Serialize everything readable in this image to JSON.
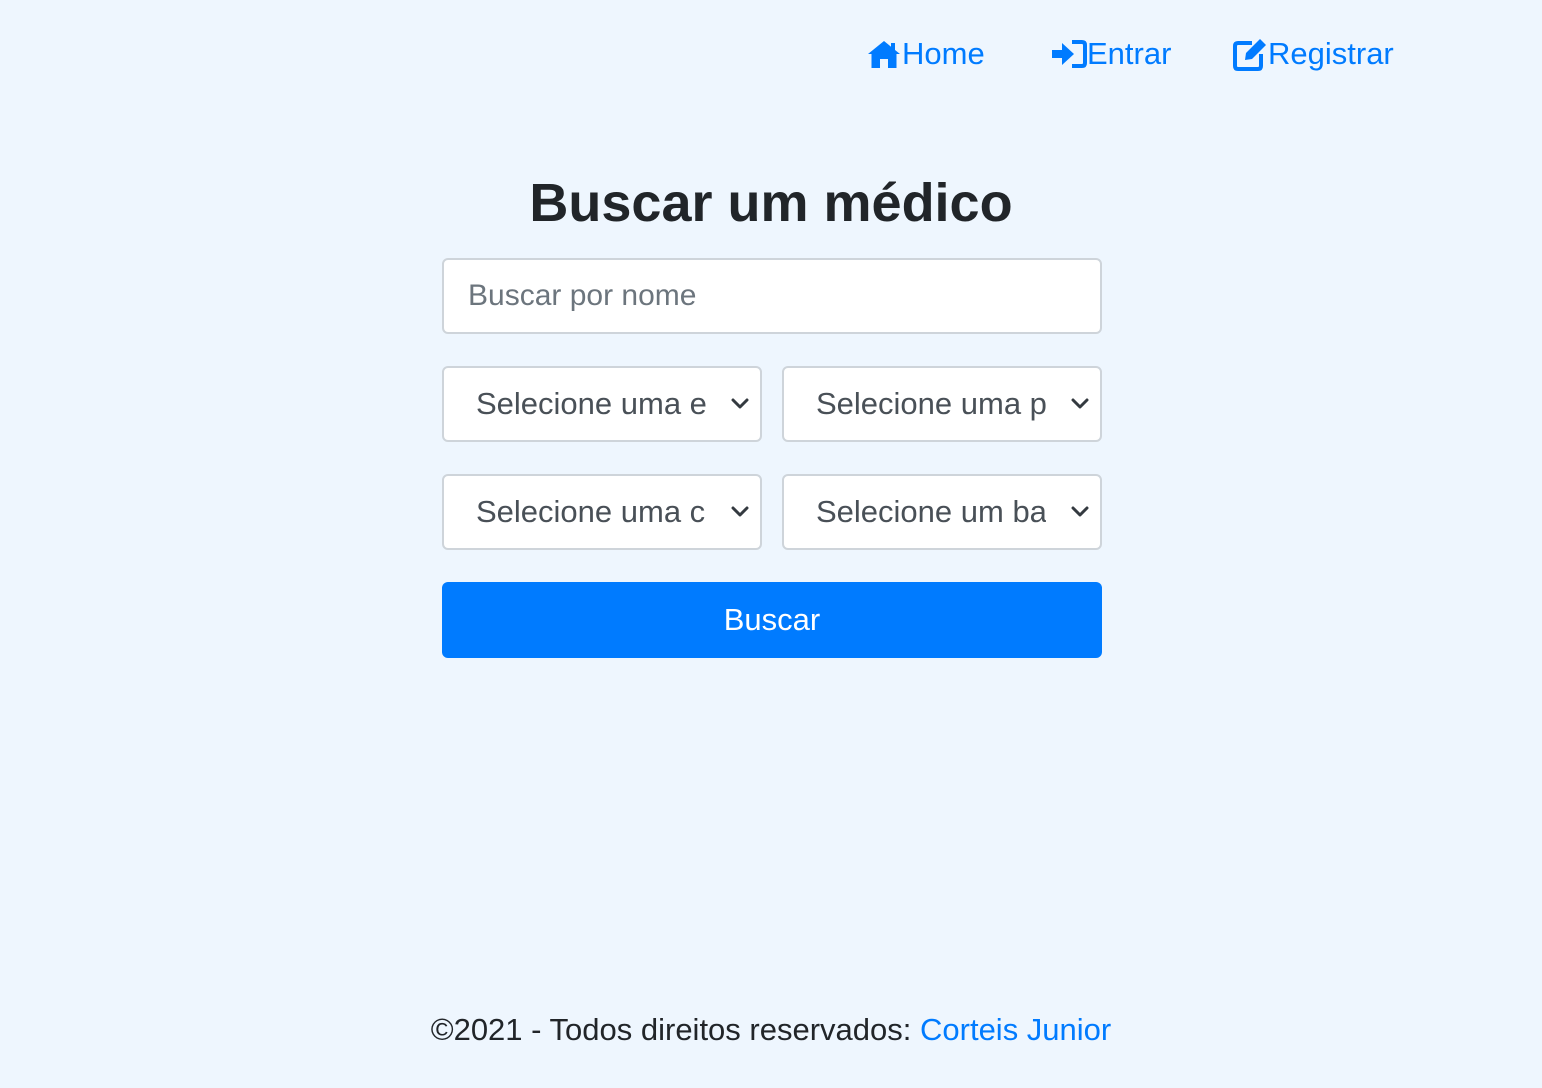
{
  "nav": {
    "home": {
      "label": "Home",
      "icon": "home-icon"
    },
    "login": {
      "label": "Entrar",
      "icon": "sign-in-icon"
    },
    "register": {
      "label": "Registrar",
      "icon": "edit-icon"
    }
  },
  "main": {
    "title": "Buscar um médico",
    "name_search": {
      "placeholder": "Buscar por nome",
      "value": ""
    },
    "selects": {
      "specialty": "Selecione uma e",
      "plan": "Selecione uma p",
      "city": "Selecione uma c",
      "neighborhood": "Selecione um ba"
    },
    "search_button": "Buscar"
  },
  "footer": {
    "text": "©2021 - Todos direitos reservados:",
    "author": "Corteis Junior"
  },
  "colors": {
    "background": "#eef6fe",
    "accent": "#007bff",
    "text": "#212529",
    "border": "#ced4da"
  }
}
